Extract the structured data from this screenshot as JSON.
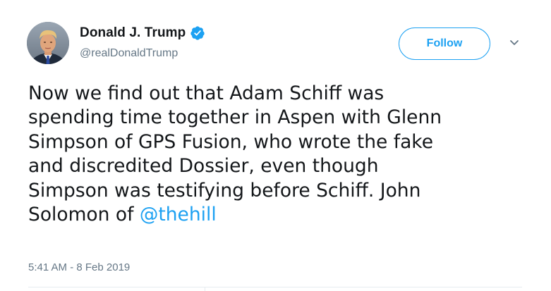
{
  "user": {
    "display_name": "Donald J. Trump",
    "handle": "@realDonaldTrump",
    "verified": true,
    "verified_icon": "verified-badge-icon",
    "avatar_icon": "profile-photo"
  },
  "actions": {
    "follow_label": "Follow",
    "menu_icon": "chevron-down-icon"
  },
  "tweet": {
    "lines": [
      "Now we find out that Adam Schiff was",
      "spending time together in Aspen with Glenn",
      "Simpson of GPS Fusion, who wrote the fake",
      "and discredited Dossier, even though",
      "Simpson was testifying before Schiff. John",
      "Solomon of "
    ],
    "mention": "@thehill",
    "timestamp": "5:41 AM - 8 Feb 2019"
  },
  "colors": {
    "accent": "#1da1f2",
    "text": "#14171a",
    "secondary": "#657786"
  }
}
